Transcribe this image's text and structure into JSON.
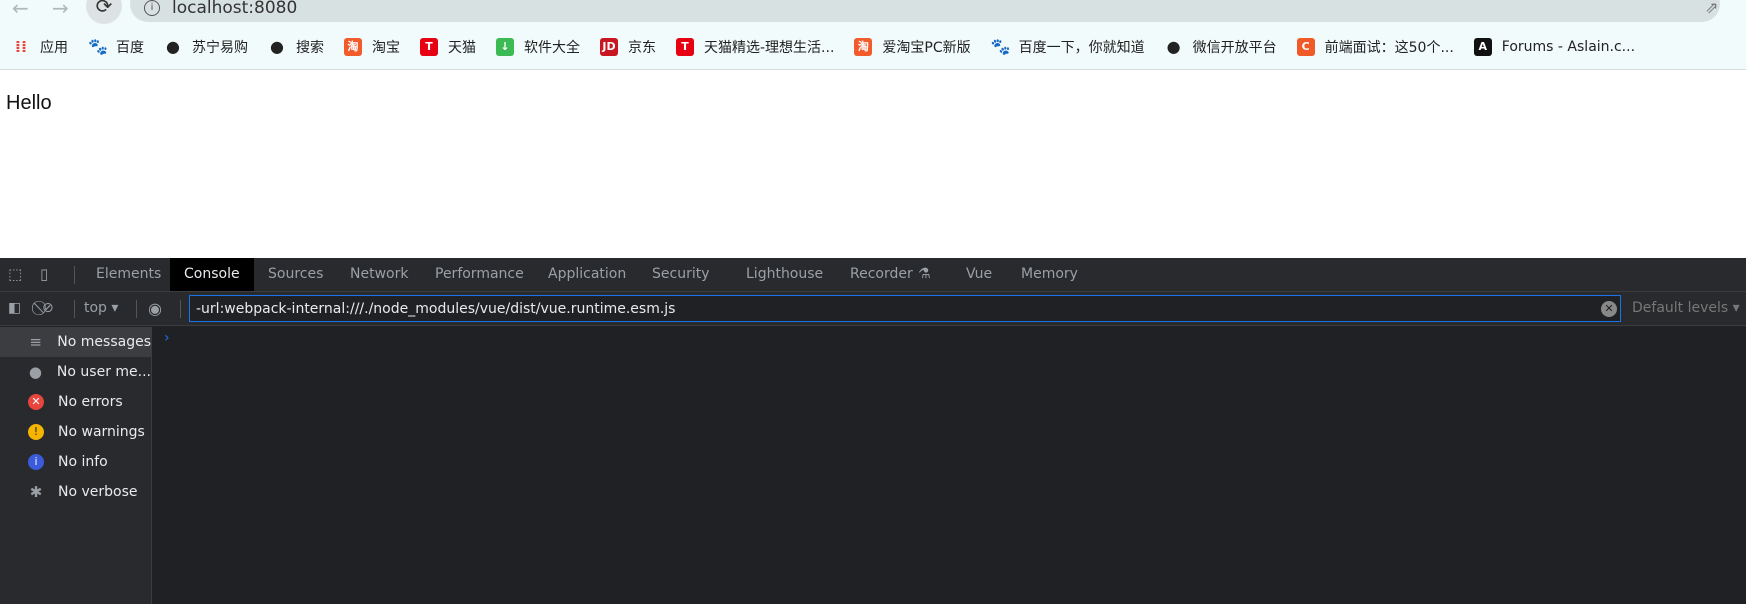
{
  "browser": {
    "url": "localhost:8080"
  },
  "bookmarks": [
    {
      "label": "应用",
      "icon": "apps-grid-icon",
      "color": "#e8453c"
    },
    {
      "label": "百度",
      "icon": "baidu-paw-icon",
      "color": "#2932e1"
    },
    {
      "label": "苏宁易购",
      "icon": "globe-icon",
      "color": "#222"
    },
    {
      "label": "搜索",
      "icon": "globe-icon",
      "color": "#222"
    },
    {
      "label": "淘宝",
      "icon": "taobao-icon",
      "color": "#f25b2a"
    },
    {
      "label": "天猫",
      "icon": "tmall-icon",
      "color": "#e60012"
    },
    {
      "label": "软件大全",
      "icon": "download-icon",
      "color": "#3cba54"
    },
    {
      "label": "京东",
      "icon": "jd-icon",
      "color": "#c81623"
    },
    {
      "label": "天猫精选-理想生活...",
      "icon": "tmall-icon",
      "color": "#e60012"
    },
    {
      "label": "爱淘宝PC新版",
      "icon": "taobao-icon",
      "color": "#f25b2a"
    },
    {
      "label": "百度一下，你就知道",
      "icon": "baidu-paw-icon",
      "color": "#2932e1"
    },
    {
      "label": "微信开放平台",
      "icon": "globe-icon",
      "color": "#222"
    },
    {
      "label": "前端面试：这50个...",
      "icon": "csdn-icon",
      "color": "#f05a28"
    },
    {
      "label": "Forums - Aslain.c...",
      "icon": "aslain-icon",
      "color": "#111"
    }
  ],
  "page": {
    "text": "Hello"
  },
  "devtools": {
    "tabs": [
      "Elements",
      "Console",
      "Sources",
      "Network",
      "Performance",
      "Application",
      "Security",
      "Lighthouse",
      "Recorder",
      "Vue",
      "Memory"
    ],
    "active_tab": "Console",
    "context": "top",
    "filter_value": "-url:webpack-internal:///./node_modules/vue/dist/vue.runtime.esm.js",
    "levels": "Default levels",
    "sidebar": [
      {
        "label": "No messages",
        "icon": "list-icon",
        "color": "#9aa0a6"
      },
      {
        "label": "No user me...",
        "icon": "user-icon",
        "color": "#9aa0a6"
      },
      {
        "label": "No errors",
        "icon": "error-icon",
        "color": "#e8453c"
      },
      {
        "label": "No warnings",
        "icon": "warning-icon",
        "color": "#f4b400"
      },
      {
        "label": "No info",
        "icon": "info-icon",
        "color": "#3b5bdb"
      },
      {
        "label": "No verbose",
        "icon": "bug-icon",
        "color": "#9aa0a6"
      }
    ]
  }
}
